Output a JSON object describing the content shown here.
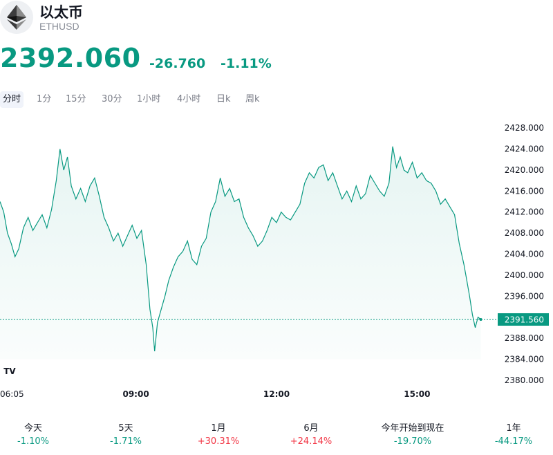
{
  "asset": {
    "name": "以太币",
    "symbol": "ETHUSD",
    "price": "2392.060",
    "change": "-26.760",
    "change_pct": "-1.11%",
    "logo_icon": "ethereum-icon"
  },
  "timeframes": [
    {
      "label": "分时",
      "active": true
    },
    {
      "label": "1分",
      "active": false
    },
    {
      "label": "15分",
      "active": false
    },
    {
      "label": "30分",
      "active": false
    },
    {
      "label": "1小时",
      "active": false
    },
    {
      "label": "4小时",
      "active": false
    },
    {
      "label": "日k",
      "active": false
    },
    {
      "label": "周k",
      "active": false
    }
  ],
  "colors": {
    "up": "#089981",
    "down": "#f23645",
    "line": "#089981",
    "text": "#131722",
    "muted": "#787b86"
  },
  "chart_data": {
    "type": "area",
    "ylim": [
      2378,
      2430
    ],
    "y_ticks": [
      "2428.000",
      "2424.000",
      "2420.000",
      "2416.000",
      "2412.000",
      "2408.000",
      "2404.000",
      "2400.000",
      "2396.000",
      "2392.000",
      "2388.000",
      "2384.000",
      "2380.000"
    ],
    "x_ticks": [
      {
        "label": "06:05",
        "hour": 6.08,
        "bold": false
      },
      {
        "label": "09:00",
        "hour": 9.0,
        "bold": true
      },
      {
        "label": "12:00",
        "hour": 12.0,
        "bold": true
      },
      {
        "label": "15:00",
        "hour": 15.0,
        "bold": true
      }
    ],
    "x_range_hours": [
      6.1,
      17.9
    ],
    "last_price": "2391.560",
    "last_price_value": 2391.56,
    "watermark_icon": "tradingview-logo-icon",
    "series": [
      {
        "points": [
          [
            6.1,
            2414.0
          ],
          [
            6.18,
            2412.0
          ],
          [
            6.26,
            2408.0
          ],
          [
            6.34,
            2406.0
          ],
          [
            6.42,
            2403.5
          ],
          [
            6.5,
            2405.0
          ],
          [
            6.6,
            2409.0
          ],
          [
            6.7,
            2411.0
          ],
          [
            6.8,
            2408.5
          ],
          [
            6.9,
            2410.0
          ],
          [
            7.0,
            2411.5
          ],
          [
            7.1,
            2409.0
          ],
          [
            7.2,
            2412.5
          ],
          [
            7.3,
            2418.0
          ],
          [
            7.38,
            2424.0
          ],
          [
            7.46,
            2420.0
          ],
          [
            7.54,
            2422.5
          ],
          [
            7.62,
            2417.0
          ],
          [
            7.72,
            2414.5
          ],
          [
            7.82,
            2416.5
          ],
          [
            7.92,
            2414.0
          ],
          [
            8.02,
            2417.0
          ],
          [
            8.12,
            2418.5
          ],
          [
            8.22,
            2415.0
          ],
          [
            8.32,
            2411.0
          ],
          [
            8.42,
            2409.0
          ],
          [
            8.52,
            2406.5
          ],
          [
            8.62,
            2408.0
          ],
          [
            8.72,
            2405.5
          ],
          [
            8.82,
            2407.5
          ],
          [
            8.92,
            2409.5
          ],
          [
            9.02,
            2407.0
          ],
          [
            9.12,
            2408.5
          ],
          [
            9.22,
            2402.0
          ],
          [
            9.3,
            2393.5
          ],
          [
            9.36,
            2390.0
          ],
          [
            9.4,
            2385.5
          ],
          [
            9.46,
            2391.0
          ],
          [
            9.54,
            2393.5
          ],
          [
            9.62,
            2396.0
          ],
          [
            9.7,
            2399.0
          ],
          [
            9.8,
            2401.5
          ],
          [
            9.9,
            2403.5
          ],
          [
            10.0,
            2404.5
          ],
          [
            10.1,
            2406.5
          ],
          [
            10.2,
            2403.0
          ],
          [
            10.3,
            2402.0
          ],
          [
            10.4,
            2405.5
          ],
          [
            10.5,
            2407.0
          ],
          [
            10.6,
            2412.0
          ],
          [
            10.7,
            2414.0
          ],
          [
            10.8,
            2418.5
          ],
          [
            10.9,
            2415.0
          ],
          [
            11.0,
            2416.5
          ],
          [
            11.1,
            2414.0
          ],
          [
            11.2,
            2414.5
          ],
          [
            11.3,
            2411.0
          ],
          [
            11.4,
            2409.0
          ],
          [
            11.5,
            2407.5
          ],
          [
            11.6,
            2405.5
          ],
          [
            11.7,
            2406.5
          ],
          [
            11.8,
            2408.5
          ],
          [
            11.9,
            2411.0
          ],
          [
            12.0,
            2410.0
          ],
          [
            12.1,
            2412.0
          ],
          [
            12.2,
            2411.0
          ],
          [
            12.3,
            2410.5
          ],
          [
            12.4,
            2412.0
          ],
          [
            12.5,
            2413.5
          ],
          [
            12.6,
            2417.5
          ],
          [
            12.7,
            2419.5
          ],
          [
            12.8,
            2418.5
          ],
          [
            12.9,
            2420.5
          ],
          [
            13.0,
            2421.0
          ],
          [
            13.1,
            2418.0
          ],
          [
            13.2,
            2419.5
          ],
          [
            13.3,
            2417.0
          ],
          [
            13.4,
            2414.5
          ],
          [
            13.5,
            2416.0
          ],
          [
            13.6,
            2414.0
          ],
          [
            13.7,
            2417.0
          ],
          [
            13.8,
            2414.5
          ],
          [
            13.9,
            2415.5
          ],
          [
            14.0,
            2419.0
          ],
          [
            14.1,
            2417.5
          ],
          [
            14.2,
            2416.0
          ],
          [
            14.3,
            2415.0
          ],
          [
            14.4,
            2417.5
          ],
          [
            14.48,
            2424.5
          ],
          [
            14.56,
            2420.5
          ],
          [
            14.64,
            2422.5
          ],
          [
            14.72,
            2420.0
          ],
          [
            14.8,
            2419.5
          ],
          [
            14.9,
            2421.5
          ],
          [
            15.0,
            2418.5
          ],
          [
            15.1,
            2419.5
          ],
          [
            15.2,
            2418.0
          ],
          [
            15.3,
            2417.5
          ],
          [
            15.4,
            2416.0
          ],
          [
            15.5,
            2413.5
          ],
          [
            15.6,
            2414.5
          ],
          [
            15.7,
            2413.0
          ],
          [
            15.8,
            2411.5
          ],
          [
            15.9,
            2406.0
          ],
          [
            16.0,
            2402.0
          ],
          [
            16.06,
            2399.0
          ],
          [
            16.12,
            2396.0
          ],
          [
            16.18,
            2392.5
          ],
          [
            16.24,
            2390.0
          ],
          [
            16.3,
            2392.0
          ],
          [
            16.36,
            2391.56
          ]
        ]
      }
    ]
  },
  "ranges": [
    {
      "label": "今天",
      "value": "-1.10%",
      "dir": "down"
    },
    {
      "label": "5天",
      "value": "-1.71%",
      "dir": "down"
    },
    {
      "label": "1月",
      "value": "+30.31%",
      "dir": "up"
    },
    {
      "label": "6月",
      "value": "+24.14%",
      "dir": "up"
    },
    {
      "label": "今年开始到现在",
      "value": "-19.70%",
      "dir": "down"
    },
    {
      "label": "1年",
      "value": "-44.17%",
      "dir": "down"
    }
  ]
}
